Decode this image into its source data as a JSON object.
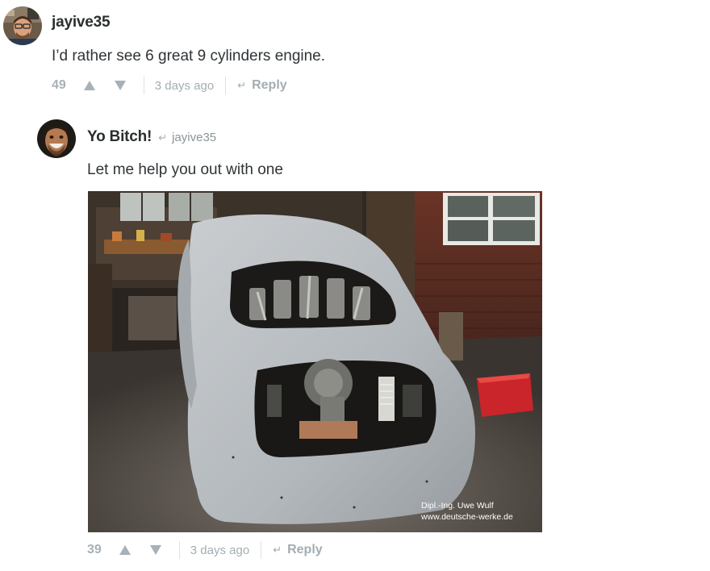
{
  "comments": [
    {
      "author": "jayive35",
      "text": "I’d rather see 6 great 9 cylinders engine.",
      "votes": "49",
      "time": "3 days ago",
      "reply_label": "Reply"
    },
    {
      "author": "Yo Bitch!",
      "reply_to": "jayive35",
      "text": "Let me help you out with one",
      "image_watermark_line1": "Dipl.-Ing. Uwe Wulf",
      "image_watermark_line2": "www.deutsche-werke.de",
      "votes": "39",
      "time": "3 days ago",
      "reply_label": "Reply"
    }
  ],
  "icons": {
    "upvote": "upvote-triangle-icon",
    "downvote": "downvote-triangle-icon",
    "reply": "reply-arrow-icon",
    "in_reply_to": "in-reply-to-arrow-icon"
  },
  "colors": {
    "text": "#2a2e2e",
    "meta": "#a3adb2",
    "divider": "#dde2e5"
  }
}
